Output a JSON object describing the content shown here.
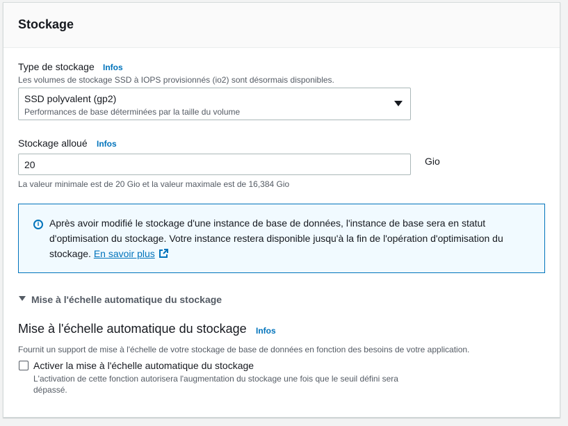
{
  "panel": {
    "title": "Stockage"
  },
  "storage_type": {
    "label": "Type de stockage",
    "info": "Infos",
    "description": "Les volumes de stockage SSD à IOPS provisionnés (io2) sont désormais disponibles.",
    "selected_value": "SSD polyvalent (gp2)",
    "selected_description": "Performances de base déterminées par la taille du volume"
  },
  "allocated_storage": {
    "label": "Stockage alloué",
    "info": "Infos",
    "value": "20",
    "unit": "Gio",
    "constraint": "La valeur minimale est de 20 Gio et la valeur maximale est de 16,384 Gio"
  },
  "alert": {
    "text": "Après avoir modifié le stockage d'une instance de base de données, l'instance de base sera en statut d'optimisation du stockage. Votre instance restera disponible jusqu'à la fin de l'opération d'optimisation du stockage.",
    "link": "En savoir plus",
    "color": "#0073bb",
    "background": "#f1faff"
  },
  "autoscaling": {
    "expander_label": "Mise à l'échelle automatique du stockage",
    "title": "Mise à l'échelle automatique du stockage",
    "info": "Infos",
    "description": "Fournit un support de mise à l'échelle de votre stockage de base de données en fonction des besoins de votre application.",
    "checkbox_label": "Activer la mise à l'échelle automatique du stockage",
    "checkbox_checked": false,
    "checkbox_description_line1": "L'activation de cette fonction autorisera l'augmentation du stockage une fois que le seuil défini sera",
    "checkbox_description_line2": "dépassé."
  },
  "icons": {
    "info": "info-circle-icon",
    "dropdown": "caret-down-icon",
    "external": "external-link-icon",
    "expand": "caret-down-icon",
    "checkbox": "checkbox-icon"
  }
}
